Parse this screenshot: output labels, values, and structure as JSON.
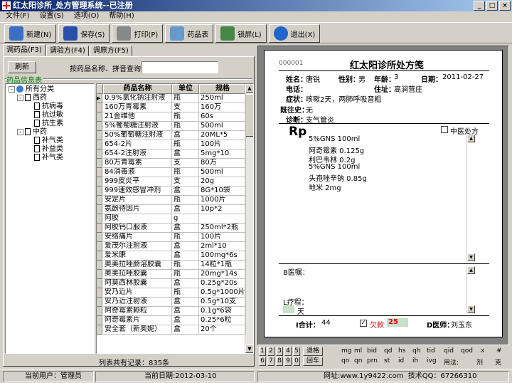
{
  "window": {
    "title": "红太阳诊所_处方管理系统--已注册",
    "controls": [
      "_",
      "□",
      "×"
    ]
  },
  "menu": [
    "文件(F)",
    "设置(S)",
    "选项(O)",
    "帮助(H)"
  ],
  "toolbar": [
    {
      "label": "新建(N)",
      "icon": "new-doc-icon",
      "color": "#3b6fc4"
    },
    {
      "label": "保存(S)",
      "icon": "save-disk-icon",
      "color": "#2a4fa8"
    },
    {
      "label": "打印(P)",
      "icon": "printer-icon",
      "color": "#888888"
    },
    {
      "label": "药品表",
      "icon": "table-icon",
      "color": "#6699cc"
    },
    {
      "label": "锁屏(L)",
      "icon": "lock-screen-icon",
      "color": "#448844"
    },
    {
      "label": "退出(X)",
      "icon": "power-icon",
      "color": "#2266cc"
    }
  ],
  "tabs": [
    "调药品(F3)",
    "调验方(F4)",
    "调原方(F5)"
  ],
  "search": {
    "refresh_label": "刷新",
    "query_label": "按药品名称、拼音查询",
    "value": ""
  },
  "group_label": "药品信息表",
  "tree": [
    {
      "label": "所有分类",
      "level": 0,
      "type": "root",
      "toggle": "-"
    },
    {
      "label": "西药",
      "level": 1,
      "type": "folder",
      "toggle": "-"
    },
    {
      "label": "抗病毒",
      "level": 2,
      "type": "leaf"
    },
    {
      "label": "抗过敏",
      "level": 2,
      "type": "leaf"
    },
    {
      "label": "抗生素",
      "level": 2,
      "type": "leaf"
    },
    {
      "label": "中药",
      "level": 1,
      "type": "folder",
      "toggle": "-"
    },
    {
      "label": "补气类",
      "level": 2,
      "type": "leaf"
    },
    {
      "label": "补益类",
      "level": 2,
      "type": "leaf"
    },
    {
      "label": "补气类",
      "level": 2,
      "type": "leaf"
    }
  ],
  "drug_table": {
    "columns": [
      "药品名称",
      "单位",
      "规格"
    ],
    "rows": [
      [
        "0.9%氯化钠注射液",
        "瓶",
        "250ml"
      ],
      [
        "160万青霉素",
        "支",
        "160万"
      ],
      [
        "21金维他",
        "瓶",
        "60s"
      ],
      [
        "5%葡萄糖注射液",
        "瓶",
        "500ml"
      ],
      [
        "50%葡萄糖注射液",
        "盒",
        "20ML*5"
      ],
      [
        "654-2片",
        "瓶",
        "100片"
      ],
      [
        "654-2注射液",
        "盒",
        "5mg*10"
      ],
      [
        "80万青霉素",
        "支",
        "80万"
      ],
      [
        "84消毒液",
        "瓶",
        "500ml"
      ],
      [
        "999皮炎平",
        "支",
        "20g"
      ],
      [
        "999速效感冒冲剂",
        "盒",
        "8G*10袋"
      ],
      [
        "安定片",
        "瓶",
        "1000片"
      ],
      [
        "氨酚待因片",
        "盒",
        "10p*2"
      ],
      [
        "阿胶",
        "g",
        ""
      ],
      [
        "阿胶钙口服液",
        "盒",
        "250ml*2瓶"
      ],
      [
        "安络痛片",
        "瓶",
        "100片"
      ],
      [
        "爱茂尔注射液",
        "盒",
        "2ml*10"
      ],
      [
        "爱米康",
        "盒",
        "100mg*6s"
      ],
      [
        "奥美拉唑肠溶胶囊",
        "瓶",
        "14粒*1瓶"
      ],
      [
        "奥美拉唑胶囊",
        "瓶",
        "20mg*14s"
      ],
      [
        "阿莫西林胶囊",
        "盒",
        "0.25g*20s"
      ],
      [
        "安乃近片",
        "瓶",
        "0.5g*1000片"
      ],
      [
        "安乃近注射液",
        "盒",
        "0.5g*10支"
      ],
      [
        "阿奇霉素颗粒",
        "盒",
        "0.1g*6袋"
      ],
      [
        "阿奇霉素片",
        "盒",
        "0.25*6粒"
      ],
      [
        "安全套（新奥妮）",
        "盒",
        "20个"
      ]
    ],
    "record_count": "列表共有记录：835条"
  },
  "prescription": {
    "number": "000001",
    "title": "红太阳诊所处方笺",
    "name_label": "姓名：",
    "name": "唐锐",
    "sex_label": "性别：",
    "sex": "男",
    "age_label": "年龄：",
    "age": "3",
    "date_label": "日期：",
    "date": "2011-02-27",
    "phone_label": "电话：",
    "phone": "",
    "address_label": "住址：",
    "address": "高涧营庄",
    "symptom_label": "症状：",
    "symptom": "咳嗽2天，两肺呼吸音粗",
    "history_label": "既往史：",
    "history": "无",
    "diagnosis_label": "诊断：",
    "diagnosis": "支气管炎",
    "rp": "Rp",
    "tcm_label": "中医处方",
    "tcm_checked": false,
    "rx": [
      "5%GNS  100ml",
      "阿奇霉素   0.125g",
      "利巴韦林   0.2g",
      "5%GNS  100ml",
      "头孢唑辛钠  0.85g",
      "地米  2mg"
    ],
    "advice_label": "B医嘱：",
    "course_label": "L疗程：",
    "course_value": "",
    "course_unit": "天",
    "total_label": "I合计：",
    "total": "44",
    "owe_label": "欠款",
    "owe": "25",
    "owe_checked": true,
    "doctor_label": "D医师：",
    "doctor": "刘玉东"
  },
  "keypad": {
    "row1": [
      "1",
      "2",
      "3",
      "4",
      "5"
    ],
    "row2": [
      "6",
      "7",
      "8",
      "9",
      "0"
    ],
    "back_label": "退格",
    "enter_label": "回车",
    "usage_row1": [
      "mg",
      "ml",
      "bid",
      "qd",
      "hs",
      "qh",
      "tid",
      "qid",
      "qod",
      "x",
      "#"
    ],
    "usage_row2": [
      "qn",
      "qn",
      "prn",
      "st",
      "id",
      "ih",
      "ivg",
      "用法:",
      "剂",
      "克"
    ]
  },
  "status": {
    "user": "当前用户：管理员",
    "date": "当前日期:2012-03-10",
    "site": "网址:www.1y9422.com",
    "qq": "技术QQ：67266310"
  }
}
